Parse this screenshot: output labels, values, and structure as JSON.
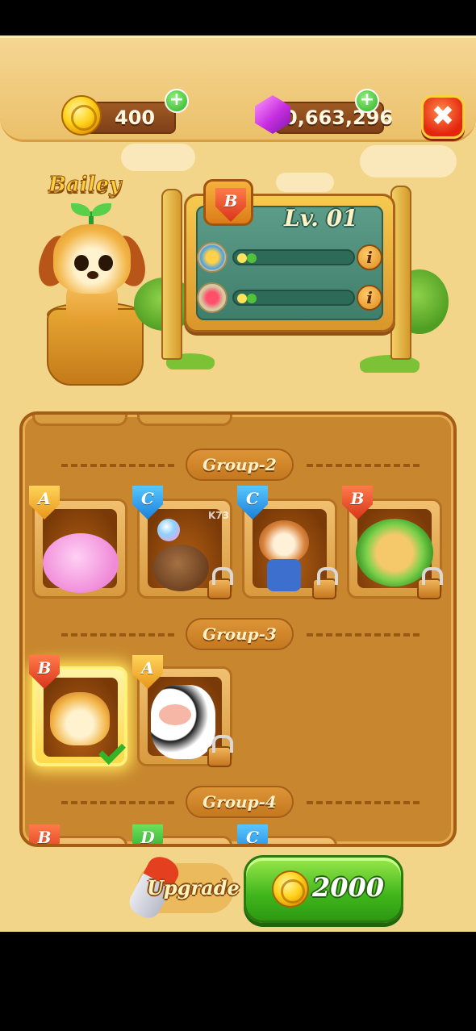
{
  "topbar": {
    "coins": "400",
    "gems": "0,663,296",
    "coins_plus": "+",
    "gems_plus": "+",
    "close_icon": "x-icon",
    "close_symbol": "✖"
  },
  "pet": {
    "name": "Bailey",
    "rank": "B",
    "level": "Lv. 01",
    "stats": [
      {
        "icon": "wings-icon",
        "info": "i"
      },
      {
        "icon": "heart-icon",
        "info": "i"
      }
    ]
  },
  "collection": {
    "groups": [
      {
        "label": "Group-2",
        "pets": [
          {
            "rank": "A",
            "creature": "pink-elephant",
            "locked": false,
            "selected": false
          },
          {
            "rank": "C",
            "creature": "seal-with-ball",
            "locked": true,
            "selected": false
          },
          {
            "rank": "C",
            "creature": "raccoon",
            "locked": true,
            "selected": false
          },
          {
            "rank": "B",
            "creature": "deer-lion",
            "locked": true,
            "selected": false
          }
        ]
      },
      {
        "label": "Group-3",
        "pets": [
          {
            "rank": "B",
            "creature": "puppy",
            "locked": false,
            "selected": true
          },
          {
            "rank": "A",
            "creature": "cow",
            "locked": true,
            "selected": false
          }
        ]
      },
      {
        "label": "Group-4",
        "pets": [
          {
            "rank": "B"
          },
          {
            "rank": "D"
          },
          {
            "rank": "C"
          }
        ]
      }
    ]
  },
  "footer": {
    "upgrade_label": "Upgrade",
    "cost": "2000"
  },
  "watermark": "K73",
  "colors": {
    "background": "#f3d58a",
    "panel": "#c8872e",
    "green_button": "#3fb61c",
    "close_button": "#e4260e"
  }
}
